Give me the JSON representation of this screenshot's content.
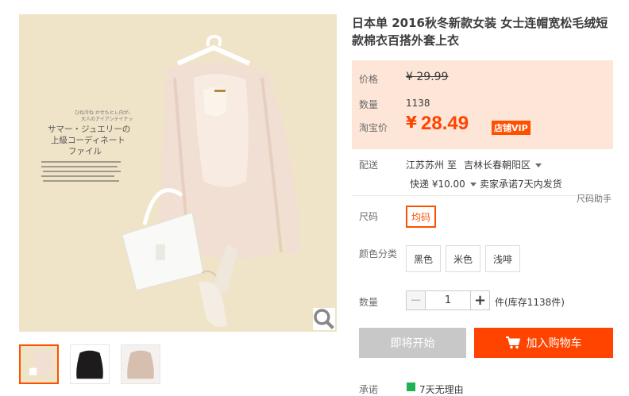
{
  "product": {
    "title": "日本单 2016秋冬新款女装 女士连帽宽松毛绒短款棉衣百搭外套上衣"
  },
  "price": {
    "list_label": "价格",
    "list_currency": "¥",
    "list_value": "29.99",
    "count_label": "数量",
    "count_value": "1138",
    "promo_label": "淘宝价",
    "promo_currency": "¥",
    "promo_value": "28.49",
    "promo_badge": "店铺VIP"
  },
  "delivery": {
    "label": "配送",
    "from": "江苏苏州",
    "to_word": "至",
    "destination": "吉林长春朝阳区",
    "express": "快递 ¥10.00",
    "promise": "卖家承诺7天内发货"
  },
  "size_helper": "尺码助手",
  "size": {
    "label": "尺码",
    "options": [
      "均码"
    ]
  },
  "color": {
    "label": "颜色分类",
    "options": [
      "黑色",
      "米色",
      "浅啡"
    ]
  },
  "quantity": {
    "label": "数量",
    "minus": "−",
    "value": "1",
    "plus": "+",
    "stock": "件(库存1138件)"
  },
  "buttons": {
    "buy": "即将开始",
    "cart": "加入购物车"
  },
  "bottom": {
    "label": "承诺",
    "text": "7天无理由"
  },
  "magazine": {
    "line1": "ひね冷ね かせたヒレ内が、",
    "line2": "大人のアイアンテイナッ",
    "headline1": "サマー・ジュエリーの",
    "headline2": "上級コーディネート",
    "headline3": "ファイル"
  },
  "colors": {
    "accent": "#ff4400",
    "panel_bg": "#fde6d8"
  }
}
